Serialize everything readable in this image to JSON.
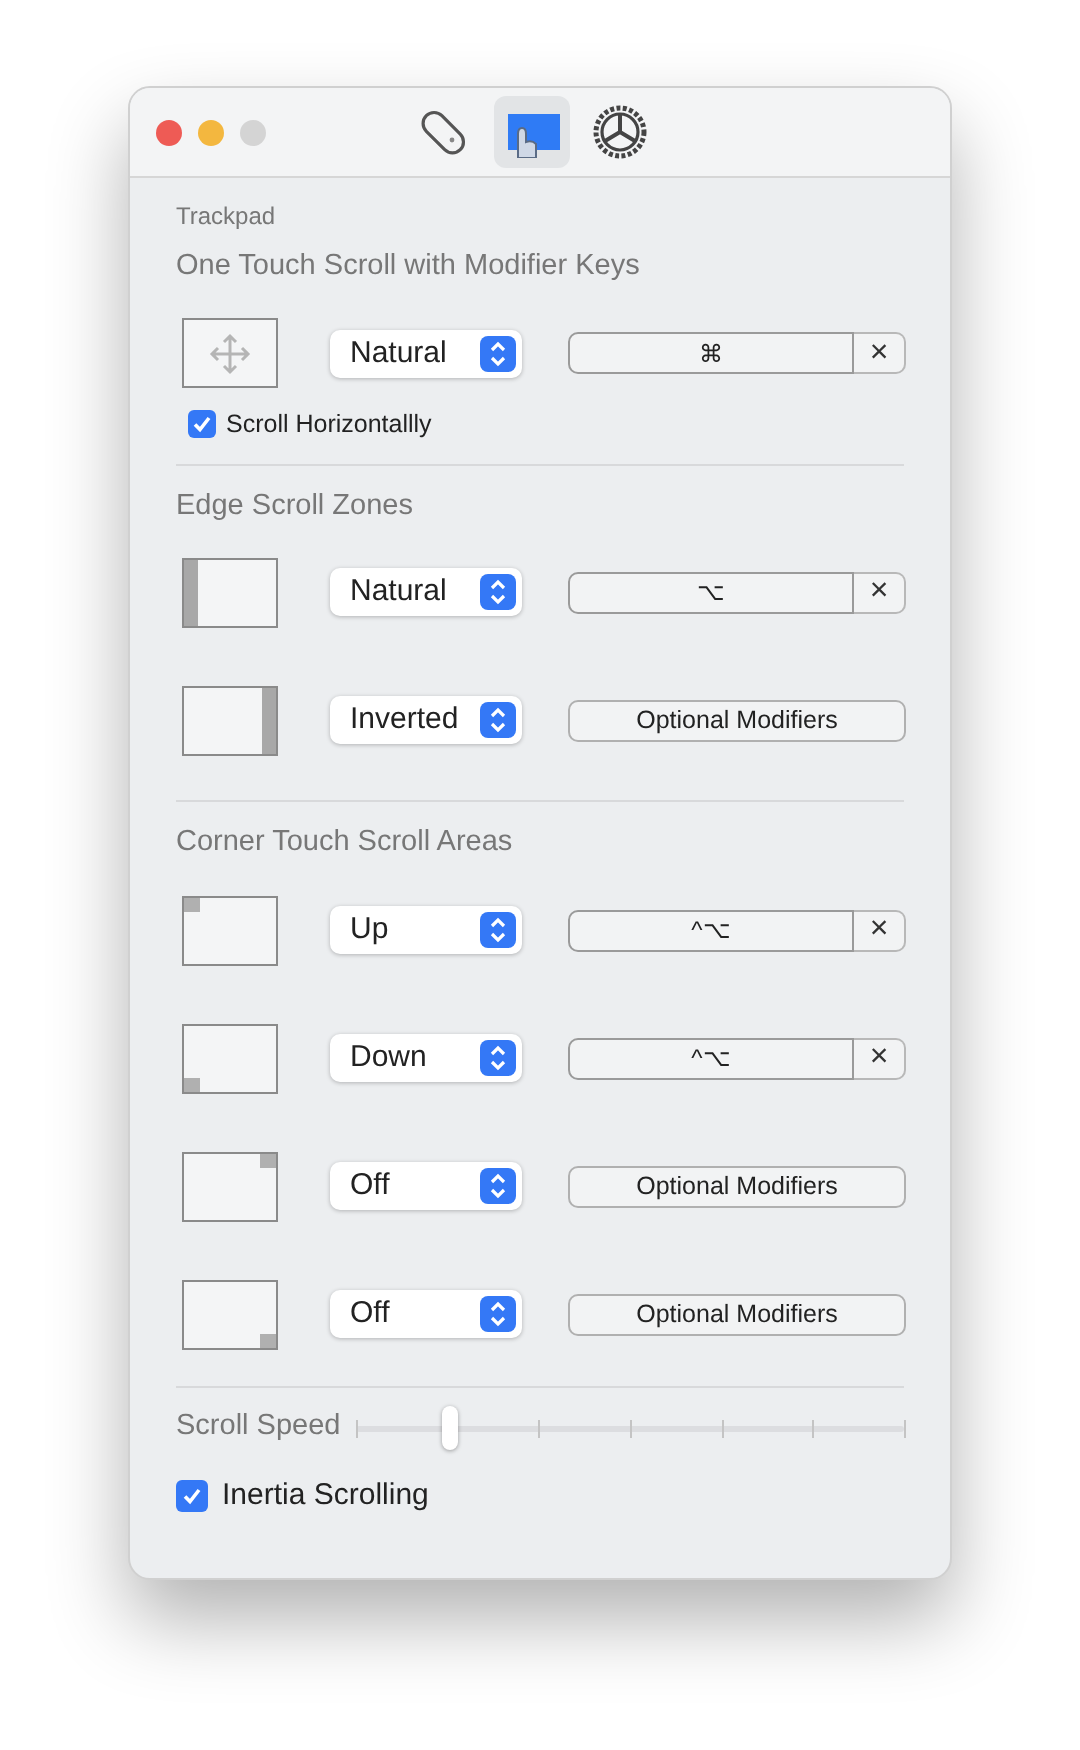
{
  "toolbar": {
    "tabs": [
      {
        "kind": "mouse",
        "selected": false
      },
      {
        "kind": "trackpad",
        "selected": true
      },
      {
        "kind": "general",
        "selected": false
      }
    ]
  },
  "section_label": "Trackpad",
  "sections": [
    {
      "title": "One Touch Scroll with Modifier Keys",
      "rows": [
        {
          "kind": "move",
          "direction": "Natural",
          "modifier": {
            "kind": "shortcut",
            "keys": "⌘",
            "clear": "×"
          }
        }
      ],
      "checkbox": {
        "label": "Scroll Horizontallly",
        "checked": true
      }
    },
    {
      "title": "Edge Scroll Zones",
      "rows": [
        {
          "kind": "edge-left",
          "direction": "Natural",
          "modifier": {
            "kind": "shortcut",
            "keys": "⌥",
            "clear": "×"
          }
        },
        {
          "kind": "edge-right",
          "direction": "Inverted",
          "modifier": {
            "kind": "button",
            "label": "Optional Modifiers"
          }
        }
      ]
    },
    {
      "title": "Corner Touch Scroll Areas",
      "rows": [
        {
          "kind": "corner-tl",
          "direction": "Up",
          "modifier": {
            "kind": "shortcut",
            "keys": "^⌥",
            "clear": "×"
          }
        },
        {
          "kind": "corner-bl",
          "direction": "Down",
          "modifier": {
            "kind": "shortcut",
            "keys": "^⌥",
            "clear": "×"
          }
        },
        {
          "kind": "corner-tr",
          "direction": "Off",
          "modifier": {
            "kind": "button",
            "label": "Optional Modifiers"
          }
        },
        {
          "kind": "corner-br",
          "direction": "Off",
          "modifier": {
            "kind": "button",
            "label": "Optional Modifiers"
          }
        }
      ]
    }
  ],
  "scroll_speed": {
    "label": "Scroll Speed",
    "level": 0.17
  },
  "inertia": {
    "label": "Inertia Scrolling",
    "checked": true
  }
}
